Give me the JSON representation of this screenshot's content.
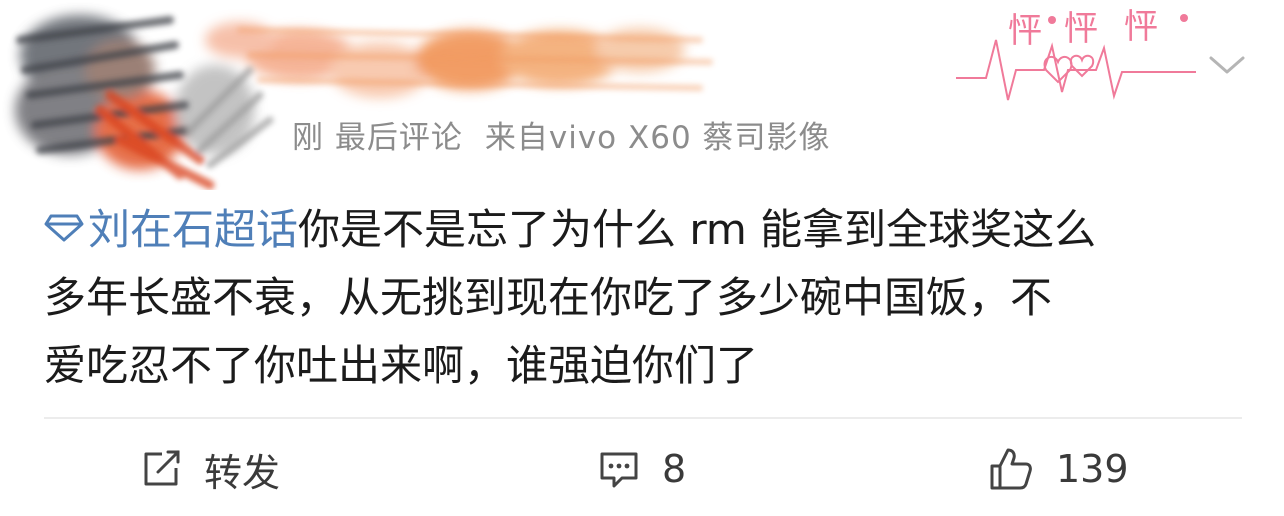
{
  "post": {
    "meta_fragment": "刚",
    "meta_time": "最后评论",
    "meta_source": "来自vivo X60 蔡司影像",
    "topic_label": "刘在石超话",
    "body_lines": [
      "你是不是忘了为什么 rm 能拿到全球奖这么",
      "多年长盛不衰，从无挑到现在你吃了多少碗中国饭，不",
      "爱吃忍不了你吐出来啊，谁强迫你们了"
    ]
  },
  "actions": {
    "repost_label": "转发",
    "comment_count": "8",
    "like_count": "139"
  },
  "decoration_text": [
    "怦",
    "怦",
    "怦"
  ],
  "colors": {
    "topic_link": "#4f7fb8",
    "meta_text": "#8c8c8c",
    "body_text": "#1b1b1b",
    "decoration_pink": "#f07a9a"
  },
  "icons": {
    "topic": "diamond-icon",
    "menu": "chevron-down-icon",
    "repost": "repost-icon",
    "comment": "comment-icon",
    "like": "thumbs-up-icon"
  }
}
